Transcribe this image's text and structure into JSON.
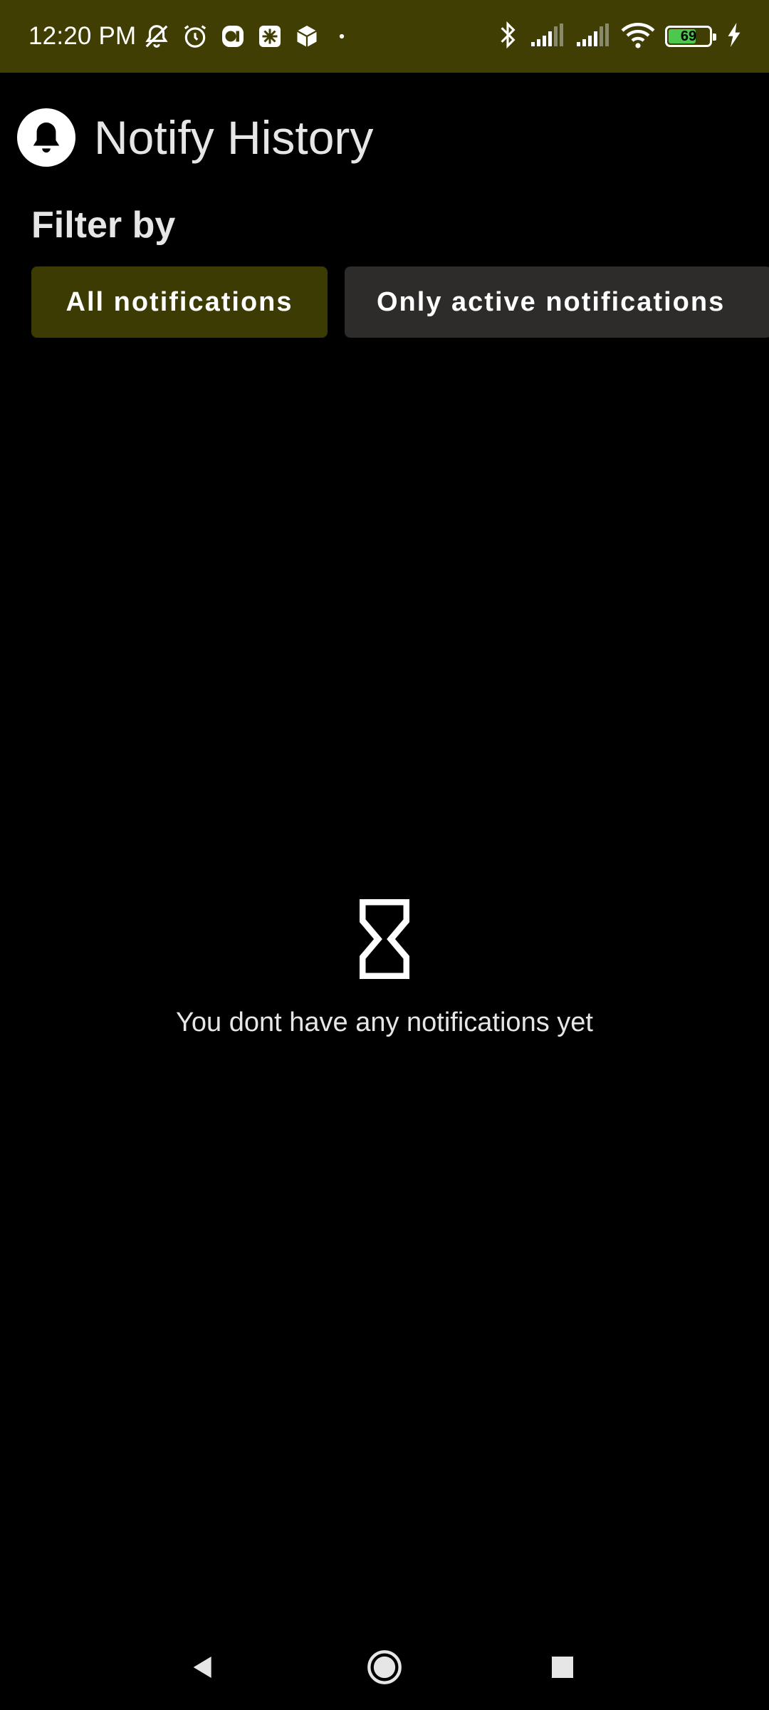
{
  "status_bar": {
    "time": "12:20 PM",
    "battery_level": "69",
    "battery_fraction": 0.69,
    "left_icons": [
      "bell-off-icon",
      "alarm-icon",
      "app-icon",
      "app-icon",
      "package-icon",
      "dot-icon"
    ],
    "right_icons": [
      "bluetooth-icon",
      "signal-icon",
      "signal-icon",
      "wifi-icon",
      "battery-icon",
      "charging-icon"
    ]
  },
  "header": {
    "title": "Notify History",
    "logo_icon": "bell-icon"
  },
  "filter": {
    "label": "Filter by",
    "options": [
      {
        "label": "All notifications",
        "selected": true
      },
      {
        "label": "Only active notifications",
        "selected": false
      }
    ]
  },
  "empty_state": {
    "icon": "hourglass-icon",
    "message": "You dont have any notifications yet"
  },
  "nav": {
    "back_icon": "back-icon",
    "home_icon": "home-icon",
    "recents_icon": "recents-icon"
  },
  "colors": {
    "accent": "#403e03",
    "chip_selected": "#3d3b04",
    "chip_unselected": "#2e2c2a",
    "background": "#000000"
  }
}
